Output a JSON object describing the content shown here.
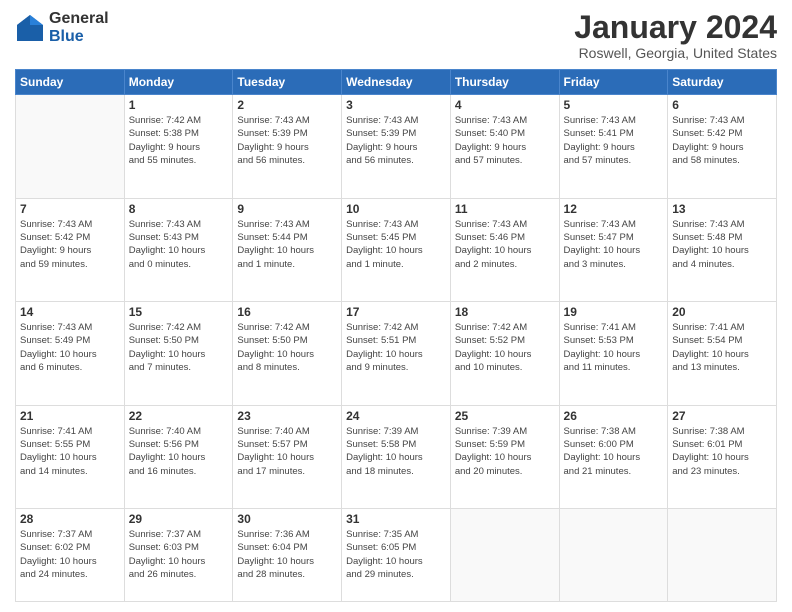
{
  "logo": {
    "general": "General",
    "blue": "Blue"
  },
  "header": {
    "month": "January 2024",
    "location": "Roswell, Georgia, United States"
  },
  "weekdays": [
    "Sunday",
    "Monday",
    "Tuesday",
    "Wednesday",
    "Thursday",
    "Friday",
    "Saturday"
  ],
  "weeks": [
    [
      {
        "day": "",
        "info": ""
      },
      {
        "day": "1",
        "info": "Sunrise: 7:42 AM\nSunset: 5:38 PM\nDaylight: 9 hours\nand 55 minutes."
      },
      {
        "day": "2",
        "info": "Sunrise: 7:43 AM\nSunset: 5:39 PM\nDaylight: 9 hours\nand 56 minutes."
      },
      {
        "day": "3",
        "info": "Sunrise: 7:43 AM\nSunset: 5:39 PM\nDaylight: 9 hours\nand 56 minutes."
      },
      {
        "day": "4",
        "info": "Sunrise: 7:43 AM\nSunset: 5:40 PM\nDaylight: 9 hours\nand 57 minutes."
      },
      {
        "day": "5",
        "info": "Sunrise: 7:43 AM\nSunset: 5:41 PM\nDaylight: 9 hours\nand 57 minutes."
      },
      {
        "day": "6",
        "info": "Sunrise: 7:43 AM\nSunset: 5:42 PM\nDaylight: 9 hours\nand 58 minutes."
      }
    ],
    [
      {
        "day": "7",
        "info": "Sunrise: 7:43 AM\nSunset: 5:42 PM\nDaylight: 9 hours\nand 59 minutes."
      },
      {
        "day": "8",
        "info": "Sunrise: 7:43 AM\nSunset: 5:43 PM\nDaylight: 10 hours\nand 0 minutes."
      },
      {
        "day": "9",
        "info": "Sunrise: 7:43 AM\nSunset: 5:44 PM\nDaylight: 10 hours\nand 1 minute."
      },
      {
        "day": "10",
        "info": "Sunrise: 7:43 AM\nSunset: 5:45 PM\nDaylight: 10 hours\nand 1 minute."
      },
      {
        "day": "11",
        "info": "Sunrise: 7:43 AM\nSunset: 5:46 PM\nDaylight: 10 hours\nand 2 minutes."
      },
      {
        "day": "12",
        "info": "Sunrise: 7:43 AM\nSunset: 5:47 PM\nDaylight: 10 hours\nand 3 minutes."
      },
      {
        "day": "13",
        "info": "Sunrise: 7:43 AM\nSunset: 5:48 PM\nDaylight: 10 hours\nand 4 minutes."
      }
    ],
    [
      {
        "day": "14",
        "info": "Sunrise: 7:43 AM\nSunset: 5:49 PM\nDaylight: 10 hours\nand 6 minutes."
      },
      {
        "day": "15",
        "info": "Sunrise: 7:42 AM\nSunset: 5:50 PM\nDaylight: 10 hours\nand 7 minutes."
      },
      {
        "day": "16",
        "info": "Sunrise: 7:42 AM\nSunset: 5:50 PM\nDaylight: 10 hours\nand 8 minutes."
      },
      {
        "day": "17",
        "info": "Sunrise: 7:42 AM\nSunset: 5:51 PM\nDaylight: 10 hours\nand 9 minutes."
      },
      {
        "day": "18",
        "info": "Sunrise: 7:42 AM\nSunset: 5:52 PM\nDaylight: 10 hours\nand 10 minutes."
      },
      {
        "day": "19",
        "info": "Sunrise: 7:41 AM\nSunset: 5:53 PM\nDaylight: 10 hours\nand 11 minutes."
      },
      {
        "day": "20",
        "info": "Sunrise: 7:41 AM\nSunset: 5:54 PM\nDaylight: 10 hours\nand 13 minutes."
      }
    ],
    [
      {
        "day": "21",
        "info": "Sunrise: 7:41 AM\nSunset: 5:55 PM\nDaylight: 10 hours\nand 14 minutes."
      },
      {
        "day": "22",
        "info": "Sunrise: 7:40 AM\nSunset: 5:56 PM\nDaylight: 10 hours\nand 16 minutes."
      },
      {
        "day": "23",
        "info": "Sunrise: 7:40 AM\nSunset: 5:57 PM\nDaylight: 10 hours\nand 17 minutes."
      },
      {
        "day": "24",
        "info": "Sunrise: 7:39 AM\nSunset: 5:58 PM\nDaylight: 10 hours\nand 18 minutes."
      },
      {
        "day": "25",
        "info": "Sunrise: 7:39 AM\nSunset: 5:59 PM\nDaylight: 10 hours\nand 20 minutes."
      },
      {
        "day": "26",
        "info": "Sunrise: 7:38 AM\nSunset: 6:00 PM\nDaylight: 10 hours\nand 21 minutes."
      },
      {
        "day": "27",
        "info": "Sunrise: 7:38 AM\nSunset: 6:01 PM\nDaylight: 10 hours\nand 23 minutes."
      }
    ],
    [
      {
        "day": "28",
        "info": "Sunrise: 7:37 AM\nSunset: 6:02 PM\nDaylight: 10 hours\nand 24 minutes."
      },
      {
        "day": "29",
        "info": "Sunrise: 7:37 AM\nSunset: 6:03 PM\nDaylight: 10 hours\nand 26 minutes."
      },
      {
        "day": "30",
        "info": "Sunrise: 7:36 AM\nSunset: 6:04 PM\nDaylight: 10 hours\nand 28 minutes."
      },
      {
        "day": "31",
        "info": "Sunrise: 7:35 AM\nSunset: 6:05 PM\nDaylight: 10 hours\nand 29 minutes."
      },
      {
        "day": "",
        "info": ""
      },
      {
        "day": "",
        "info": ""
      },
      {
        "day": "",
        "info": ""
      }
    ]
  ]
}
